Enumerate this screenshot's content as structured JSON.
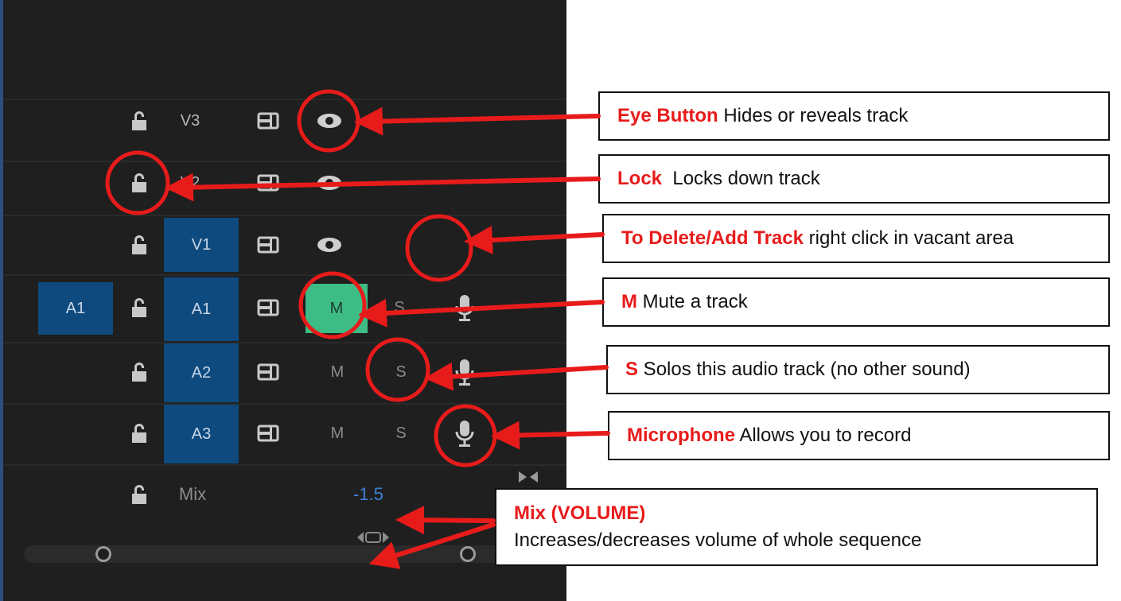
{
  "tracks": {
    "video": [
      {
        "label": "V3",
        "target": false
      },
      {
        "label": "V2",
        "target": false
      },
      {
        "label": "V1",
        "target": true
      }
    ],
    "audio": [
      {
        "label": "A1",
        "source": "A1",
        "mute": "M",
        "solo": "S",
        "mute_on": true
      },
      {
        "label": "A2",
        "source": "",
        "mute": "M",
        "solo": "S",
        "mute_on": false
      },
      {
        "label": "A3",
        "source": "",
        "mute": "M",
        "solo": "S",
        "mute_on": false
      }
    ],
    "mix": {
      "label": "Mix",
      "value": "-1.5"
    }
  },
  "callouts": {
    "eye": {
      "title": "Eye Button",
      "text": " Hides or reveals track"
    },
    "lock": {
      "title": "Lock",
      "text": "  Locks down track"
    },
    "delete": {
      "title": "To Delete/Add Track",
      "text": " right click in vacant area"
    },
    "mute": {
      "title": "M",
      "text": " Mute a track"
    },
    "solo": {
      "title": "S",
      "text": " Solos this audio track (no other sound)"
    },
    "mic": {
      "title": "Microphone",
      "text": " Allows you to record"
    },
    "mix": {
      "title": "Mix (VOLUME)",
      "text": "Increases/decreases volume of whole sequence"
    }
  },
  "colors": {
    "panel": "#1f1f1f",
    "target_blue": "#0e4a7e",
    "mute_green": "#3dbd85",
    "annotation_red": "#e81b1b"
  }
}
